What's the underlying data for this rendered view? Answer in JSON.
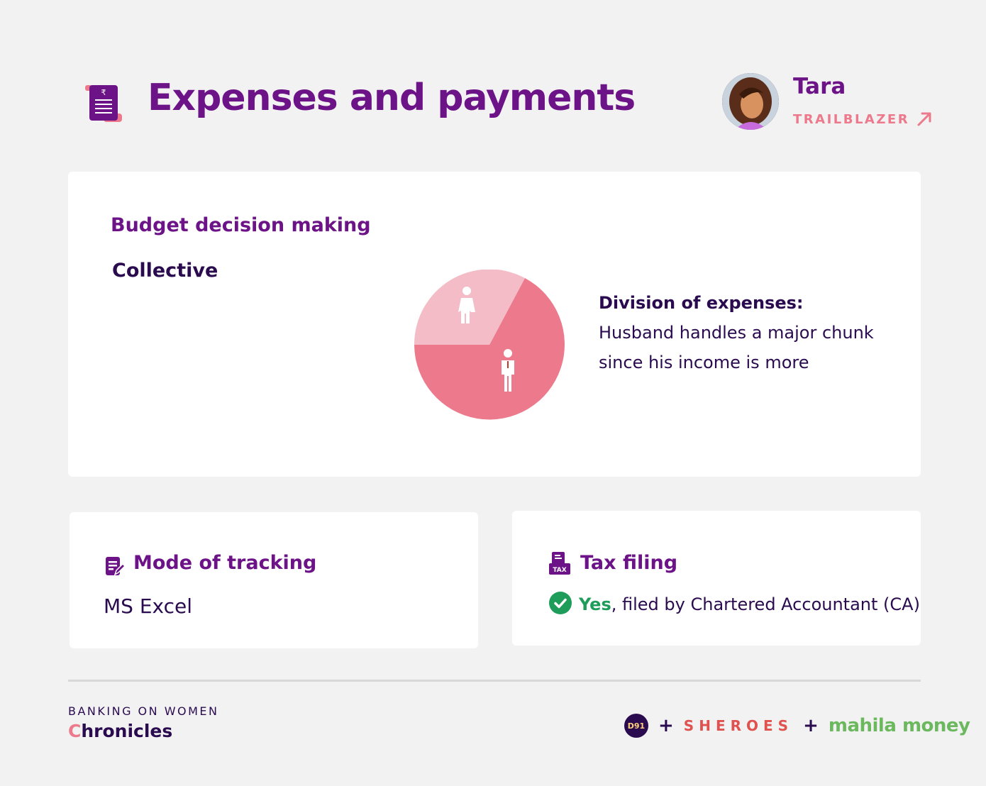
{
  "header": {
    "title": "Expenses and payments",
    "persona_name": "Tara",
    "persona_tag": "TRAILBLAZER"
  },
  "budget": {
    "title": "Budget decision making",
    "value": "Collective",
    "division_label": "Division of expenses:",
    "division_line1": "Husband handles a major chunk",
    "division_line2": "since his income is more",
    "pie_split": {
      "wife_share": 0.33,
      "husband_share": 0.67
    }
  },
  "tracking": {
    "title": "Mode of tracking",
    "value": "MS Excel"
  },
  "tax": {
    "title": "Tax filing",
    "status": "Yes",
    "detail": ", filed by Chartered Accountant (CA)",
    "icon_label": "TAX"
  },
  "footer": {
    "kicker": "BANKING ON WOMEN",
    "brand_initial": "C",
    "brand_rest": "hronicles",
    "partner1": "D91",
    "plus": "+",
    "partner2": "SHEROES",
    "partner3": "mahila money"
  },
  "colors": {
    "purple": "#6d1388",
    "navy": "#2a0b4f",
    "pink": "#ec7a8c",
    "pink_light": "#f4bcc6",
    "green": "#1e9c5a"
  },
  "icons": [
    "receipt-rupee-icon",
    "arrow-up-right-icon",
    "woman-icon",
    "man-icon",
    "edit-note-icon",
    "tax-document-icon",
    "check-circle-icon"
  ]
}
